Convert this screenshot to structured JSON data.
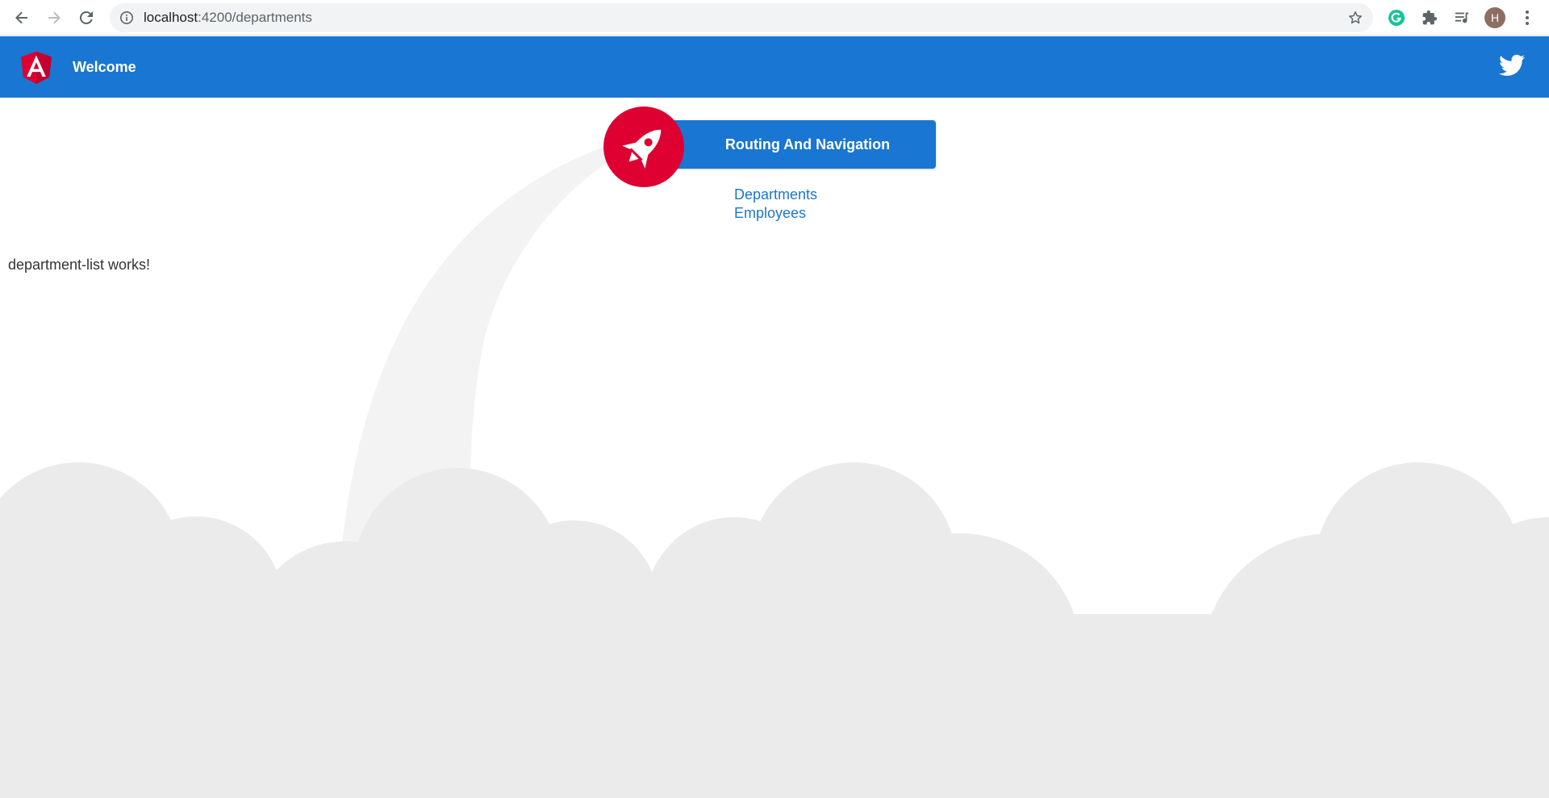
{
  "browser": {
    "url_host": "localhost",
    "url_path": ":4200/departments",
    "profile_initial": "H"
  },
  "toolbar": {
    "title": "Welcome"
  },
  "card": {
    "title": "Routing And Navigation"
  },
  "nav_links": [
    {
      "label": "Departments"
    },
    {
      "label": "Employees"
    }
  ],
  "outlet": {
    "text": "department-list works!"
  },
  "colors": {
    "primary": "#1976d2",
    "angular_red": "#dd0031",
    "cloud": "#ebebeb",
    "trail": "#f3f3f3"
  }
}
